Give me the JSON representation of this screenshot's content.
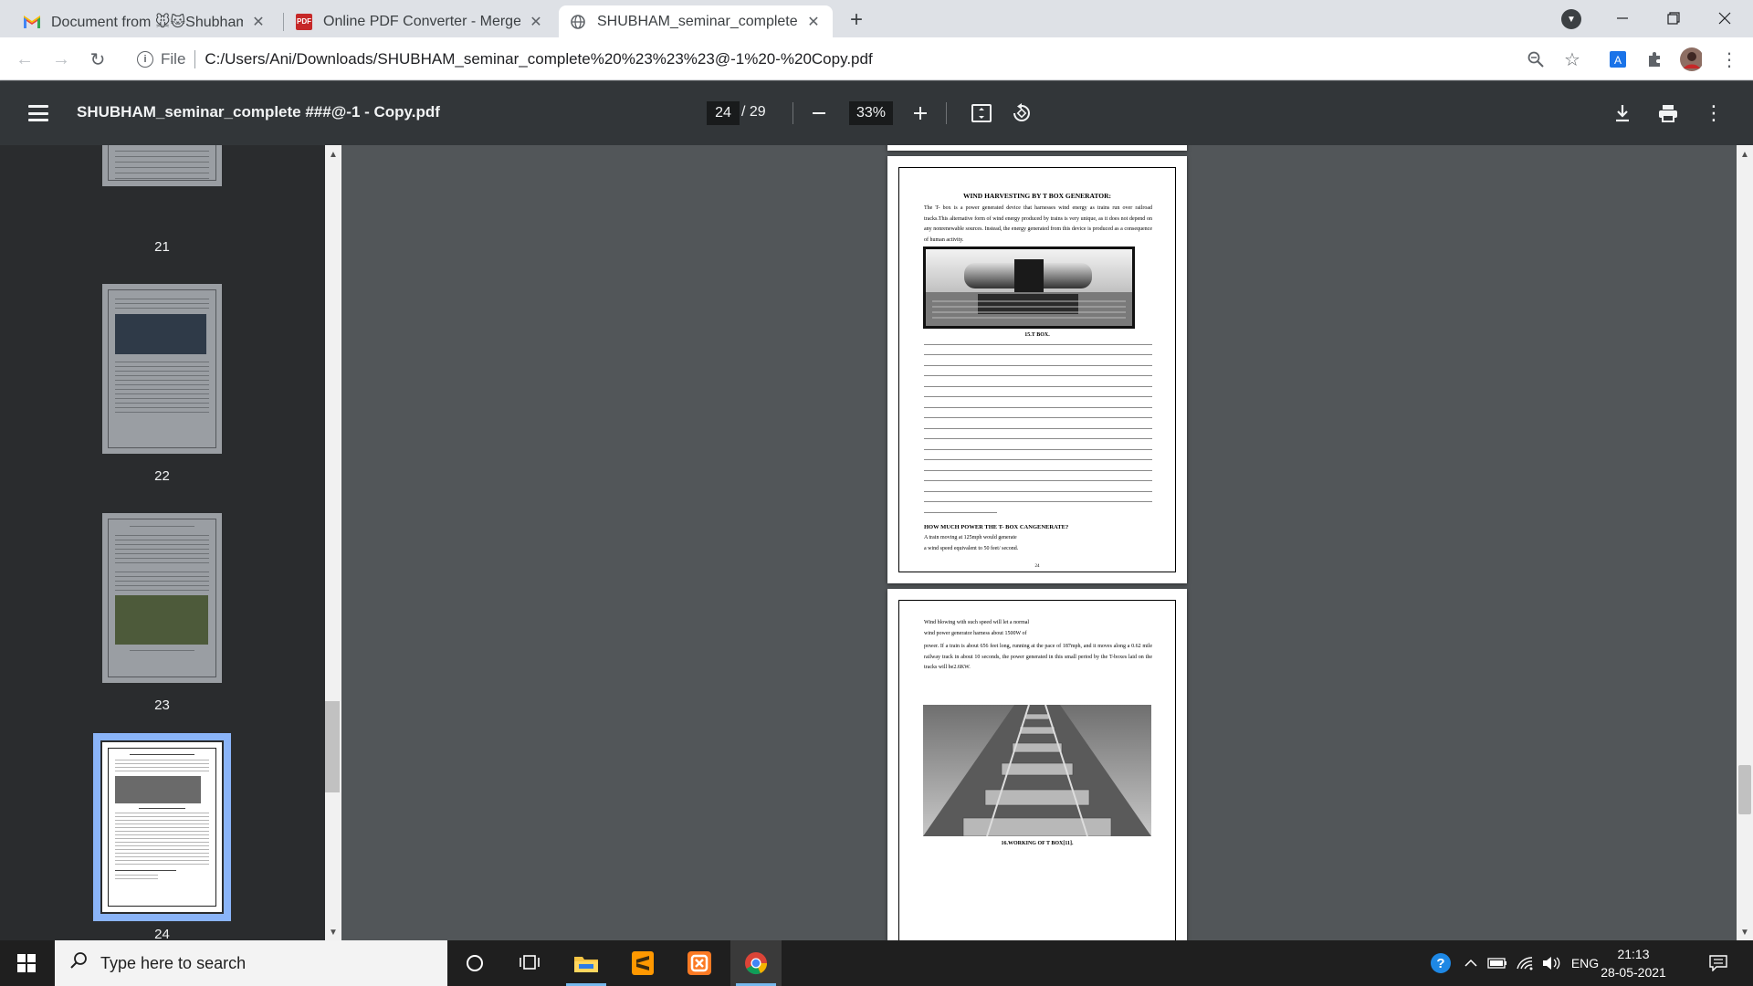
{
  "browser": {
    "tabs": [
      {
        "title": "Document from 🐭🐱Shubham🐱",
        "favicon": "gmail-icon",
        "active": false
      },
      {
        "title": "Online PDF Converter - Merge, co",
        "favicon": "pdf-icon",
        "active": false
      },
      {
        "title": "SHUBHAM_seminar_complete ##",
        "favicon": "globe-icon",
        "active": true
      }
    ],
    "new_tab_label": "+",
    "address": {
      "scheme_label": "File",
      "url": "C:/Users/Ani/Downloads/SHUBHAM_seminar_complete%20%23%23%23@-1%20-%20Copy.pdf"
    }
  },
  "pdf_viewer": {
    "document_title": "SHUBHAM_seminar_complete ###@-1 - Copy.pdf",
    "current_page": "24",
    "total_pages": "/ 29",
    "zoom": "33%",
    "thumbnails": [
      {
        "label": "21"
      },
      {
        "label": "22"
      },
      {
        "label": "23"
      },
      {
        "label": "24",
        "selected": true
      }
    ],
    "page24": {
      "heading": "WIND HARVESTING BY T BOX GENERATOR:",
      "intro": "The T- box is a power generated device that harnesses wind energy as trains run over railroad tracks.This alternative form of wind energy produced by trains is very unique, as it does not depend on any nonrenewable sources. Instead, the energy generated from this device is produced as a consequence of human activity.",
      "figure_caption": "15.T BOX.",
      "subheading": "HOW MUCH POWER THE T- BOX CANGENERATE?",
      "line1": "A train moving at 125mph would generate",
      "line2": "a wind speed equivalent to 50 feet/ second.",
      "page_number": "24"
    },
    "page25": {
      "line1": "Wind blowing with such speed will let a normal",
      "line2": "wind power generator harness about 1500W of",
      "para": "power. If a train is about 656 feet long, running at the pace of 187mph, and it moves along a 0.62 mile railway track in about 10 seconds, the power generated in this small period by the T-boxes laid on the tracks will be2.6KW.",
      "figure_caption": "16.WORKING OF T BOX[11]."
    }
  },
  "taskbar": {
    "search_placeholder": "Type here to search",
    "language": "ENG",
    "time": "21:13",
    "date": "28-05-2021"
  }
}
